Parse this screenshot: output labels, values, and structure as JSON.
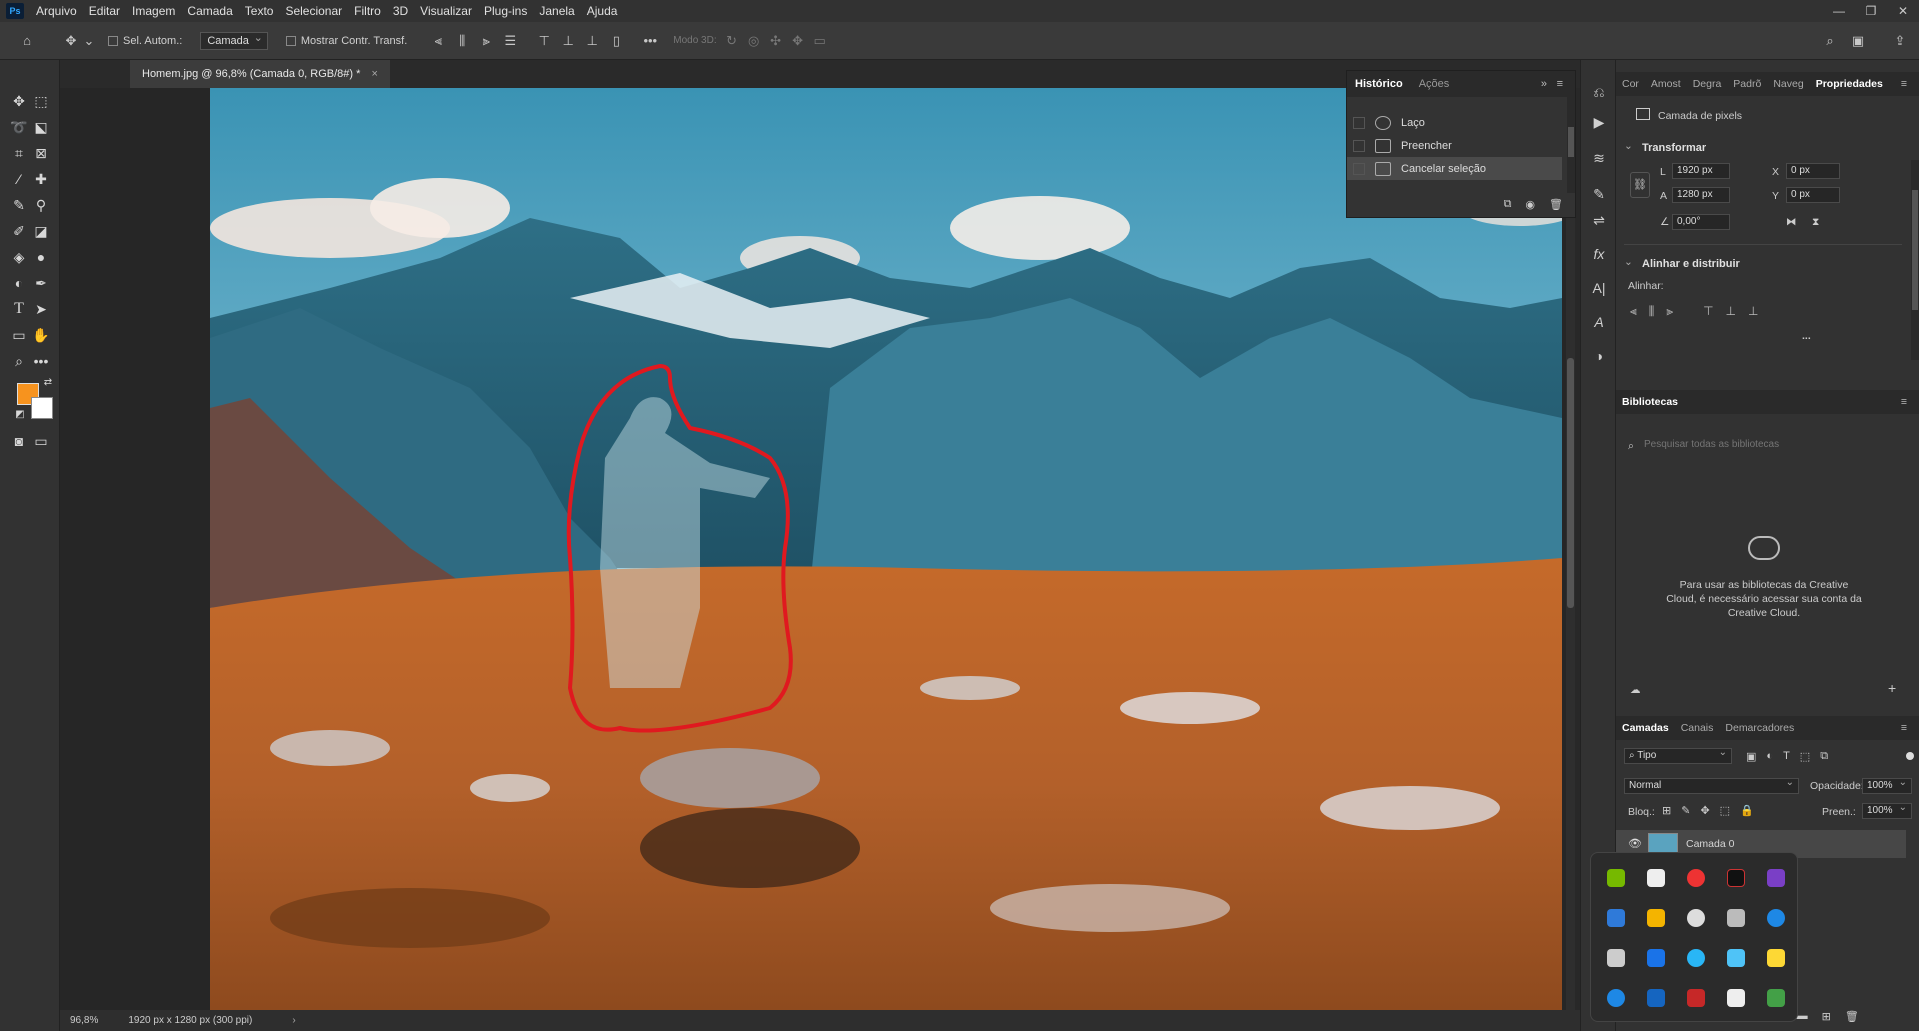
{
  "menu": {
    "logo": "Ps",
    "items": [
      "Arquivo",
      "Editar",
      "Imagem",
      "Camada",
      "Texto",
      "Selecionar",
      "Filtro",
      "3D",
      "Visualizar",
      "Plug-ins",
      "Janela",
      "Ajuda"
    ]
  },
  "options_bar": {
    "auto_select_label": "Sel. Autom.:",
    "auto_select_value": "Camada",
    "show_transform_label": "Mostrar Contr. Transf.",
    "mode_3d_label": "Modo 3D:"
  },
  "document": {
    "tab_title": "Homem.jpg @ 96,8% (Camada 0, RGB/8#) *",
    "zoom": "96,8%",
    "info": "1920 px x 1280 px (300 ppi)"
  },
  "history": {
    "tabs": [
      "Histórico",
      "Ações"
    ],
    "items": [
      "Laço",
      "Preencher",
      "Cancelar seleção"
    ]
  },
  "properties": {
    "tabs": [
      "Cor",
      "Amost",
      "Degra",
      "Padrõ",
      "Naveg",
      "Propriedades"
    ],
    "layer_type": "Camada de pixels",
    "transform_title": "Transformar",
    "w_label": "L",
    "w_value": "1920 px",
    "h_label": "A",
    "h_value": "1280 px",
    "x_label": "X",
    "x_value": "0 px",
    "y_label": "Y",
    "y_value": "0 px",
    "angle_value": "0,00°",
    "align_title": "Alinhar e distribuir",
    "align_label": "Alinhar:",
    "more": "..."
  },
  "libraries": {
    "title": "Bibliotecas",
    "search_placeholder": "Pesquisar todas as bibliotecas",
    "message": "Para usar as bibliotecas da Creative Cloud, é necessário acessar sua conta da Creative Cloud."
  },
  "layers": {
    "tabs": [
      "Camadas",
      "Canais",
      "Demarcadores"
    ],
    "filter_value": "Tipo",
    "blend_mode": "Normal",
    "opacity_label": "Opacidade:",
    "opacity_value": "100%",
    "lock_label": "Bloq.:",
    "fill_label": "Preen.:",
    "fill_value": "100%",
    "layer_name": "Camada 0"
  },
  "colors": {
    "foreground": "#f7931e",
    "background": "#ffffff",
    "selection_stroke": "#e0191f"
  }
}
